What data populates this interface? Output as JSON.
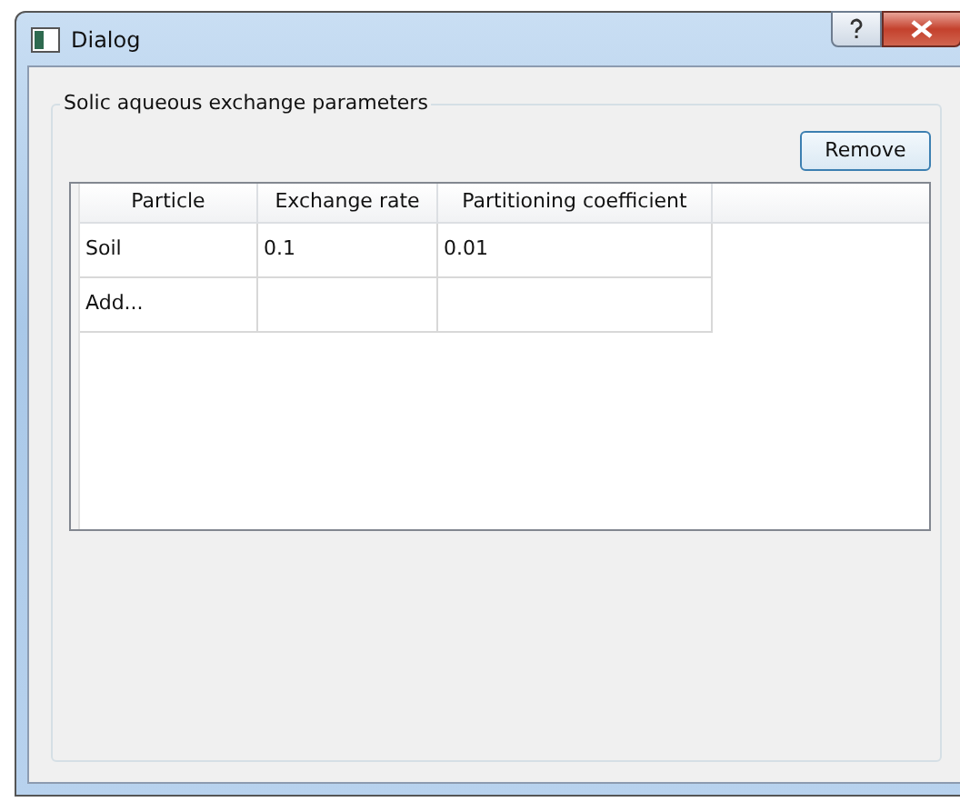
{
  "window": {
    "title": "Dialog"
  },
  "group": {
    "title": "Solic aqueous exchange parameters"
  },
  "remove_button": {
    "label": "Remove"
  },
  "table": {
    "columns": [
      "Particle",
      "Exchange rate",
      "Partitioning coefficient"
    ],
    "rows": [
      {
        "cells": [
          "Soil",
          "0.1",
          "0.01"
        ]
      },
      {
        "cells": [
          "Add...",
          "",
          ""
        ]
      }
    ]
  }
}
